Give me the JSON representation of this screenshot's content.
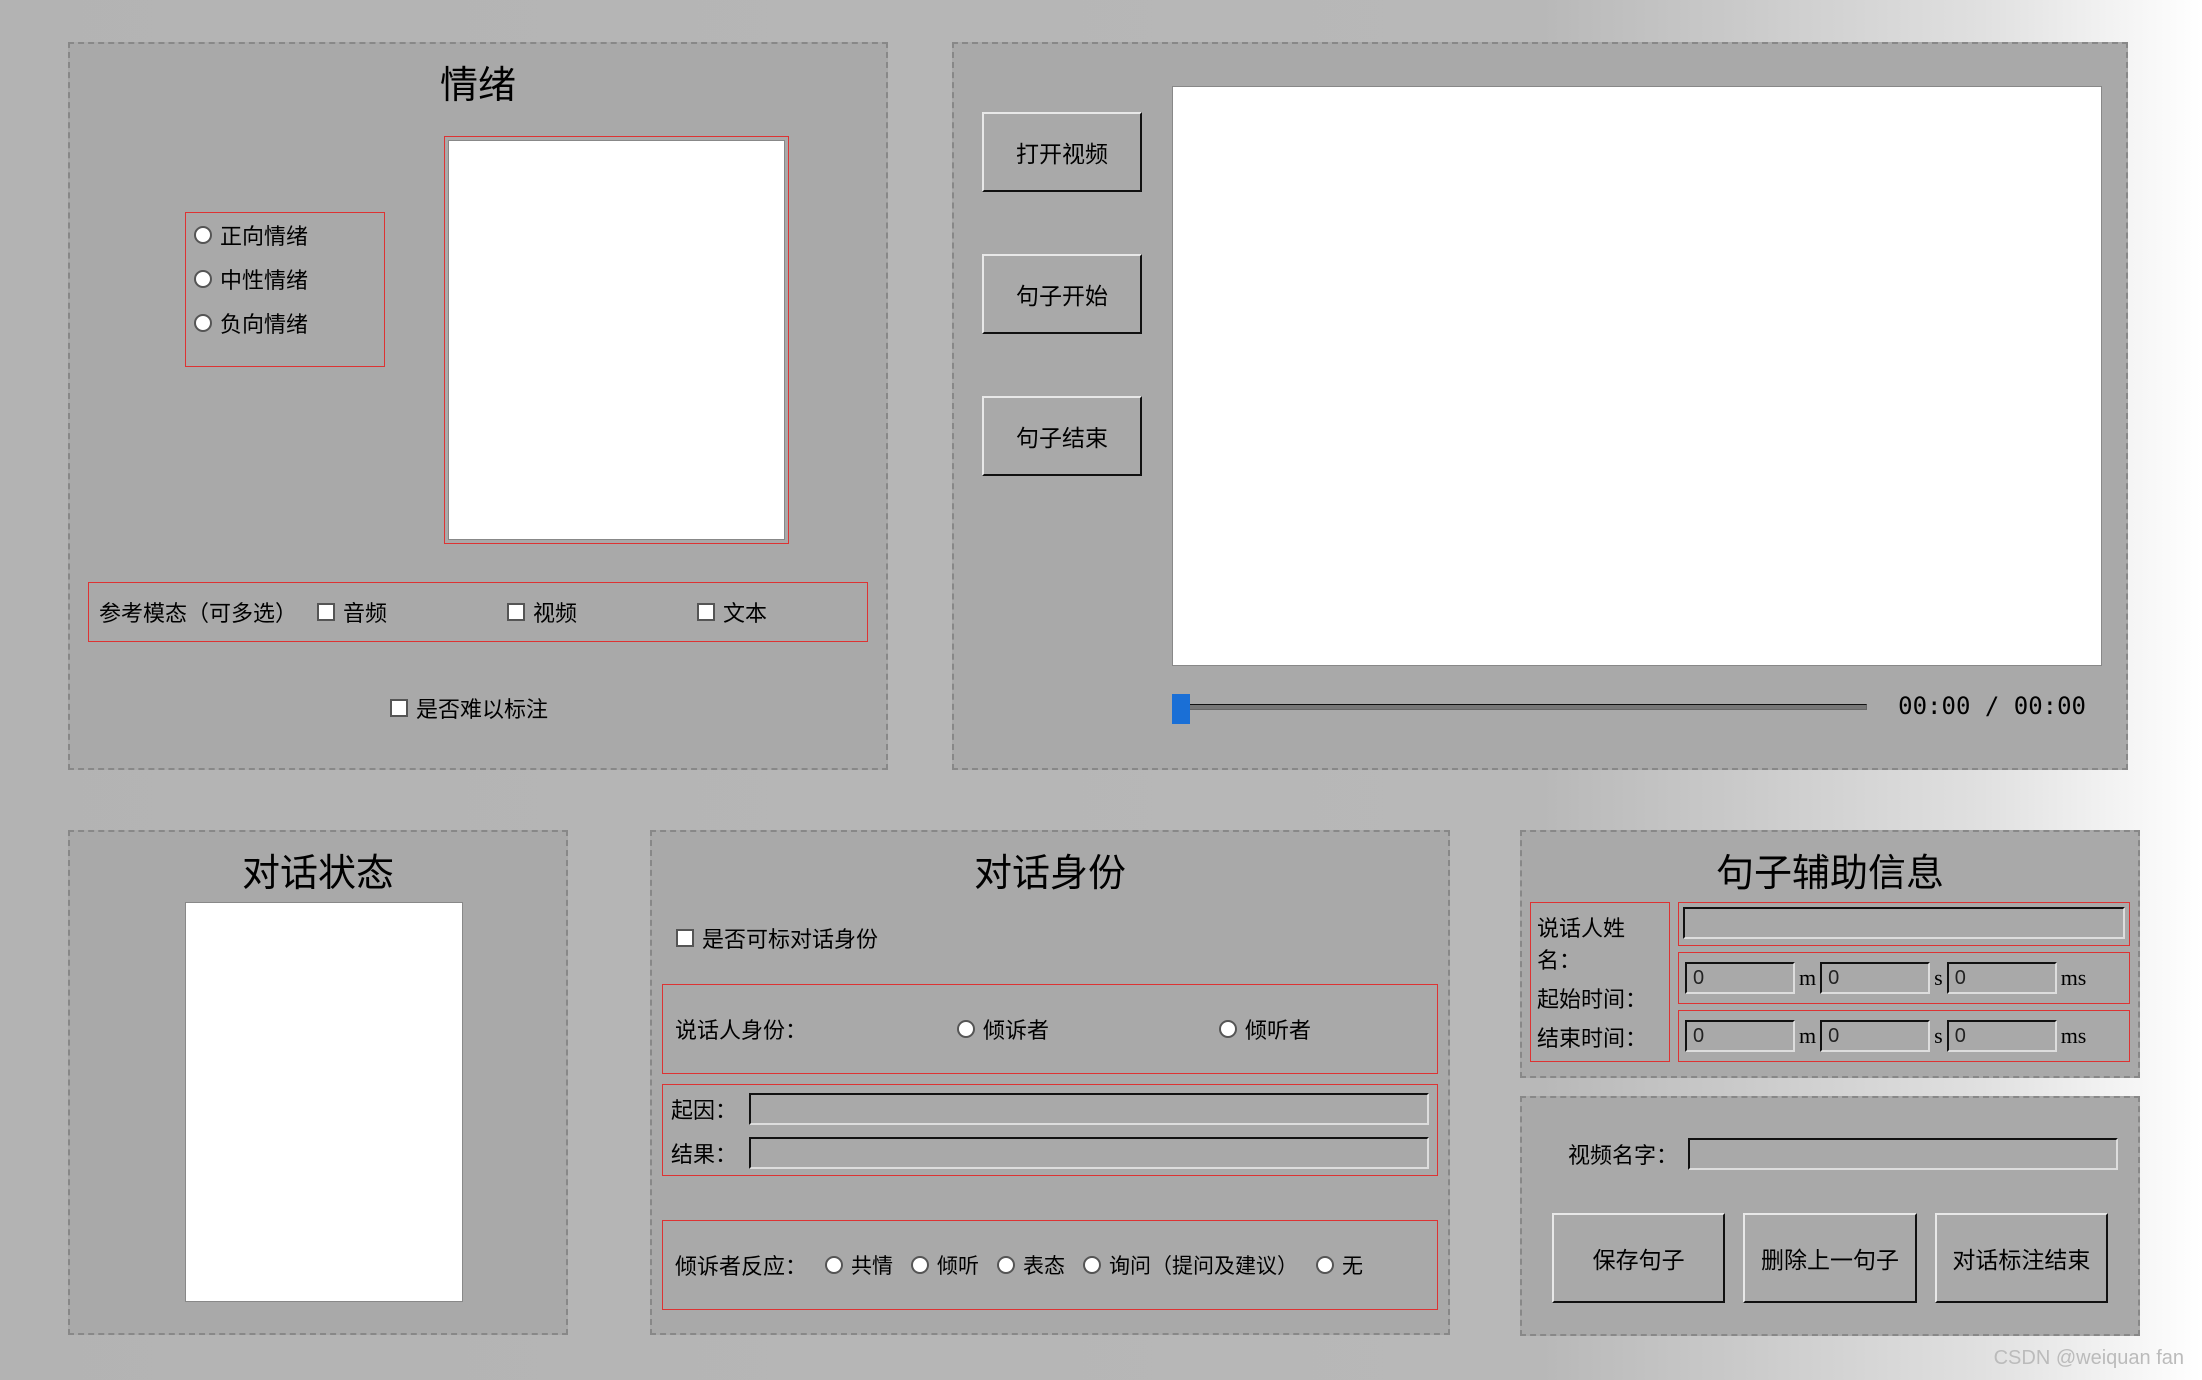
{
  "emotion": {
    "title": "情绪",
    "radios": {
      "positive": "正向情绪",
      "neutral": "中性情绪",
      "negative": "负向情绪"
    },
    "modality": {
      "label": "参考模态（可多选）",
      "audio": "音频",
      "video": "视频",
      "text": "文本"
    },
    "hard": "是否难以标注"
  },
  "video": {
    "buttons": {
      "open": "打开视频",
      "start": "句子开始",
      "end": "句子结束"
    },
    "time": "00:00 / 00:00"
  },
  "dialog_state": {
    "title": "对话状态"
  },
  "dialog_id": {
    "title": "对话身份",
    "markable": "是否可标对话身份",
    "speaker_role_label": "说话人身份：",
    "role1": "倾诉者",
    "role2": "倾听者",
    "cause_label": "起因：",
    "result_label": "结果：",
    "reaction_label": "倾诉者反应：",
    "reactions": {
      "r1": "共情",
      "r2": "倾听",
      "r3": "表态",
      "r4": "询问（提问及建议）",
      "r5": "无"
    }
  },
  "aux": {
    "title": "句子辅助信息",
    "speaker_name": "说话人姓名：",
    "start_time": "起始时间：",
    "end_time": "结束时间：",
    "m": "m",
    "s": "s",
    "ms": "ms",
    "zero": "0"
  },
  "video_name": {
    "label": "视频名字："
  },
  "save": {
    "save_sentence": "保存句子",
    "delete_prev": "删除上一句子",
    "end_mark": "对话标注结束"
  },
  "watermark": "CSDN @weiquan fan"
}
